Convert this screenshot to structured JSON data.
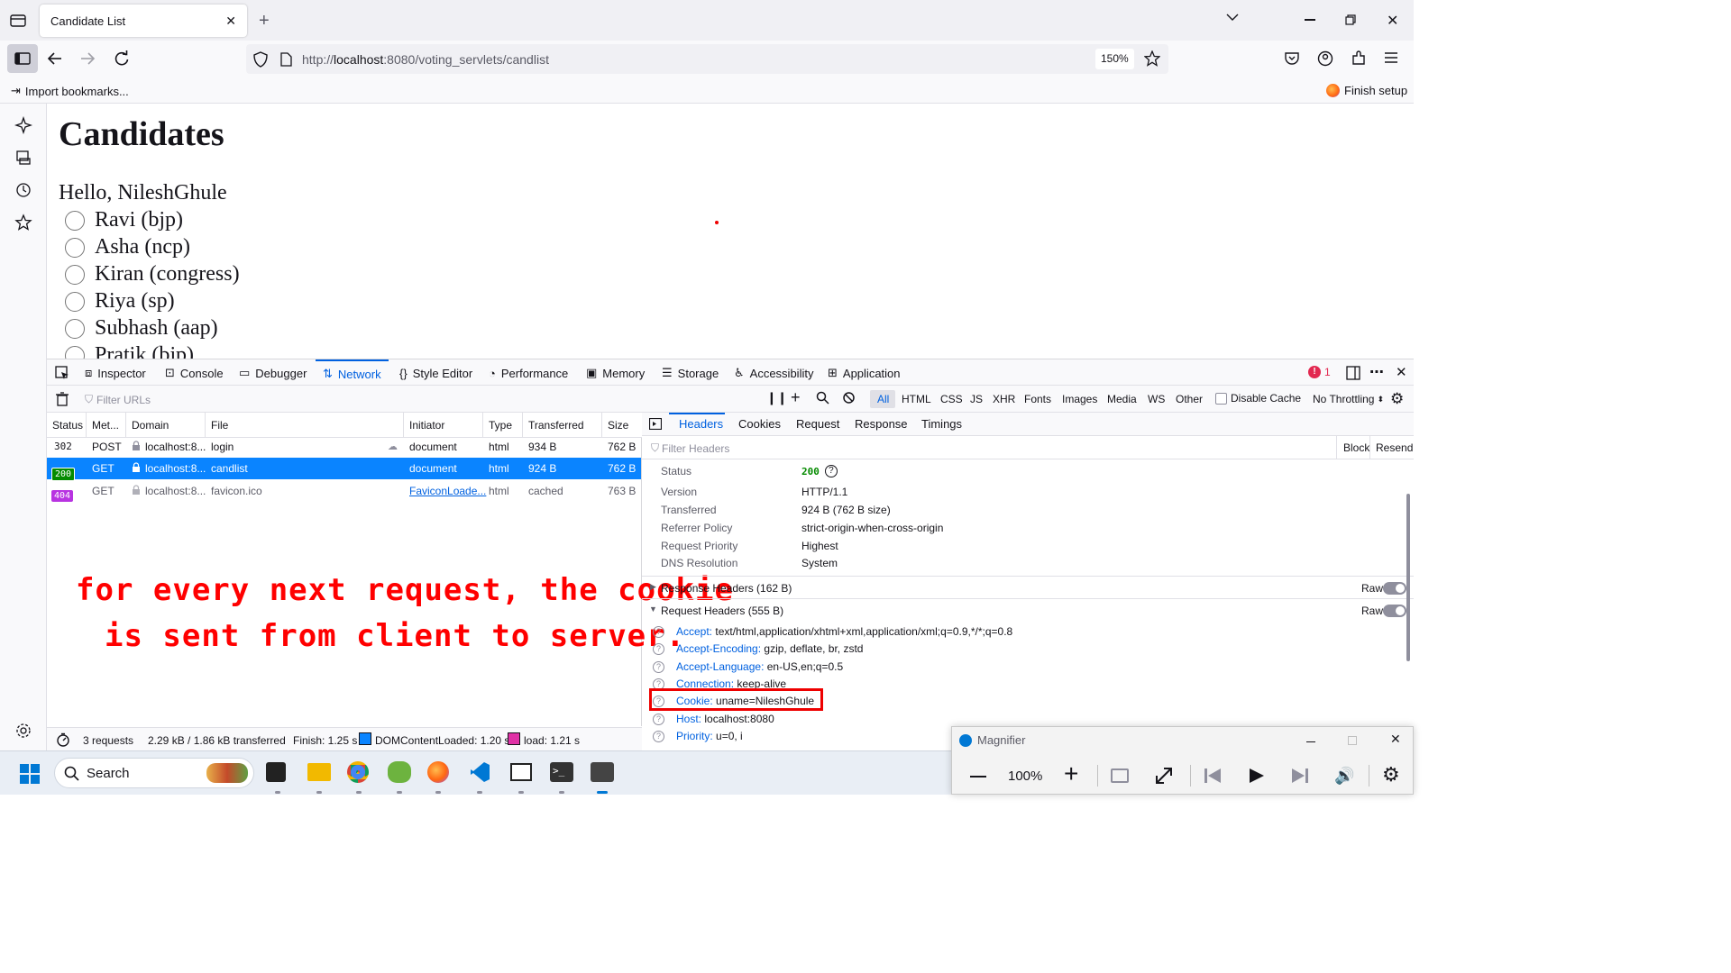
{
  "browser": {
    "tab_title": "Candidate List",
    "url_scheme": "http://",
    "url_host": "localhost",
    "url_rest": ":8080/voting_servlets/candlist",
    "zoom": "150%",
    "import_bookmarks": "Import bookmarks...",
    "finish_setup": "Finish setup"
  },
  "page": {
    "heading": "Candidates",
    "greeting": "Hello, NileshGhule",
    "candidates": [
      "Ravi (bjp)",
      "Asha (ncp)",
      "Kiran (congress)",
      "Riya (sp)",
      "Subhash (aap)",
      "Pratik (bjp)"
    ]
  },
  "devtools": {
    "tabs": [
      "Inspector",
      "Console",
      "Debugger",
      "Network",
      "Style Editor",
      "Performance",
      "Memory",
      "Storage",
      "Accessibility",
      "Application"
    ],
    "selected_tab": "Network",
    "error_count": "1",
    "filter_placeholder": "Filter URLs",
    "type_filters": [
      "All",
      "HTML",
      "CSS",
      "JS",
      "XHR",
      "Fonts",
      "Images",
      "Media",
      "WS",
      "Other"
    ],
    "disable_cache": "Disable Cache",
    "throttling": "No Throttling",
    "columns": [
      "Status",
      "Met...",
      "Domain",
      "File",
      "Initiator",
      "Type",
      "Transferred",
      "Size"
    ],
    "requests": [
      {
        "status": "302",
        "method": "POST",
        "domain": "localhost:8...",
        "file": "login",
        "initiator": "document",
        "type": "html",
        "transferred": "934 B",
        "size": "762 B"
      },
      {
        "status": "200",
        "method": "GET",
        "domain": "localhost:8...",
        "file": "candlist",
        "initiator": "document",
        "type": "html",
        "transferred": "924 B",
        "size": "762 B"
      },
      {
        "status": "404",
        "method": "GET",
        "domain": "localhost:8...",
        "file": "favicon.ico",
        "initiator": "FaviconLoade...",
        "type": "html",
        "transferred": "cached",
        "size": "763 B"
      }
    ],
    "status_bar": {
      "requests": "3 requests",
      "size": "2.29 kB / 1.86 kB transferred",
      "finish": "Finish: 1.25 s",
      "dom_loaded": "DOMContentLoaded: 1.20 s",
      "load": "load: 1.21 s"
    },
    "detail_tabs": [
      "Headers",
      "Cookies",
      "Request",
      "Response",
      "Timings"
    ],
    "filter_headers": "Filter Headers",
    "block": "Block",
    "resend": "Resend",
    "summary": [
      {
        "k": "Status",
        "v": "200"
      },
      {
        "k": "Version",
        "v": "HTTP/1.1"
      },
      {
        "k": "Transferred",
        "v": "924 B (762 B size)"
      },
      {
        "k": "Referrer Policy",
        "v": "strict-origin-when-cross-origin"
      },
      {
        "k": "Request Priority",
        "v": "Highest"
      },
      {
        "k": "DNS Resolution",
        "v": "System"
      }
    ],
    "response_headers": "Response Headers (162 B)",
    "request_headers": "Request Headers (555 B)",
    "raw": "Raw",
    "req_headers": [
      {
        "k": "Accept:",
        "v": "text/html,application/xhtml+xml,application/xml;q=0.9,*/*;q=0.8"
      },
      {
        "k": "Accept-Encoding:",
        "v": "gzip, deflate, br, zstd"
      },
      {
        "k": "Accept-Language:",
        "v": "en-US,en;q=0.5"
      },
      {
        "k": "Connection:",
        "v": "keep-alive"
      },
      {
        "k": "Cookie:",
        "v": "uname=NileshGhule"
      },
      {
        "k": "Host:",
        "v": "localhost:8080"
      },
      {
        "k": "Priority:",
        "v": "u=0, i"
      }
    ]
  },
  "annotation": {
    "line1": "for every next request, the cookie",
    "line2": "is sent from client to server.",
    "color": "#ff0000"
  },
  "taskbar": {
    "search": "Search"
  },
  "magnifier": {
    "title": "Magnifier",
    "zoom": "100%"
  },
  "colors": {
    "accent": "#0061e0",
    "selected_row": "#0a84ff",
    "status_200": "#058b00",
    "status_404": "#b833e1",
    "dom_marker": "#0a84ff",
    "load_marker": "#e031a6"
  }
}
